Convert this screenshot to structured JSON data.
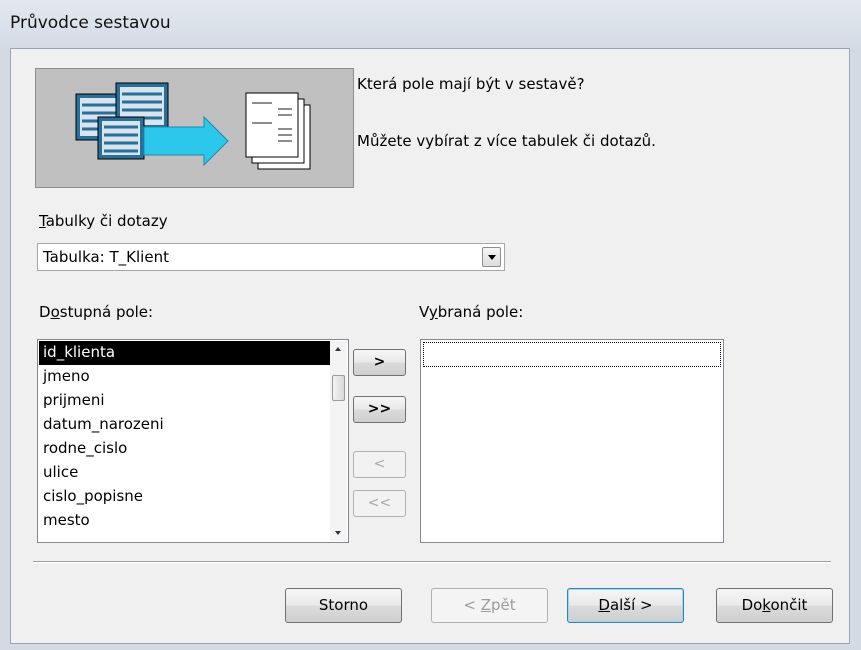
{
  "window": {
    "title": "Průvodce sestavou"
  },
  "intro": {
    "question": "Která pole mají být v sestavě?",
    "hint": "Můžete vybírat z více tabulek či dotazů."
  },
  "source": {
    "label_pre": "",
    "label_accel": "T",
    "label_post": "abulky či dotazy",
    "value": "Tabulka: T_Klient"
  },
  "available": {
    "label_pre": "D",
    "label_accel": "o",
    "label_post": "stupná pole:",
    "items": [
      {
        "label": "id_klienta",
        "selected": true
      },
      {
        "label": "jmeno",
        "selected": false
      },
      {
        "label": "prijmeni",
        "selected": false
      },
      {
        "label": "datum_narozeni",
        "selected": false
      },
      {
        "label": "rodne_cislo",
        "selected": false
      },
      {
        "label": "ulice",
        "selected": false
      },
      {
        "label": "cislo_popisne",
        "selected": false
      },
      {
        "label": "mesto",
        "selected": false
      }
    ]
  },
  "selected_fields": {
    "label_pre": "V",
    "label_accel": "y",
    "label_post": "braná pole:",
    "items": []
  },
  "move_buttons": {
    "add_one": ">",
    "add_all": ">>",
    "remove_one": "<",
    "remove_all": "<<"
  },
  "footer": {
    "cancel": "Storno",
    "back_pre": "< ",
    "back_accel": "Z",
    "back_post": "pět",
    "next_pre": "",
    "next_accel": "D",
    "next_post": "alší >",
    "finish_pre": "Do",
    "finish_accel": "k",
    "finish_post": "ončit"
  },
  "colors": {
    "dialog_bg": "#f0f0f0",
    "illustration_bg": "#c0c0c0",
    "arrow": "#2cc8ec",
    "selected_row": "#000000"
  },
  "icons": [
    "source-tables-icon",
    "arrow-right-icon",
    "report-pages-icon",
    "dropdown-arrow-icon",
    "scroll-up-icon",
    "scroll-down-icon"
  ]
}
